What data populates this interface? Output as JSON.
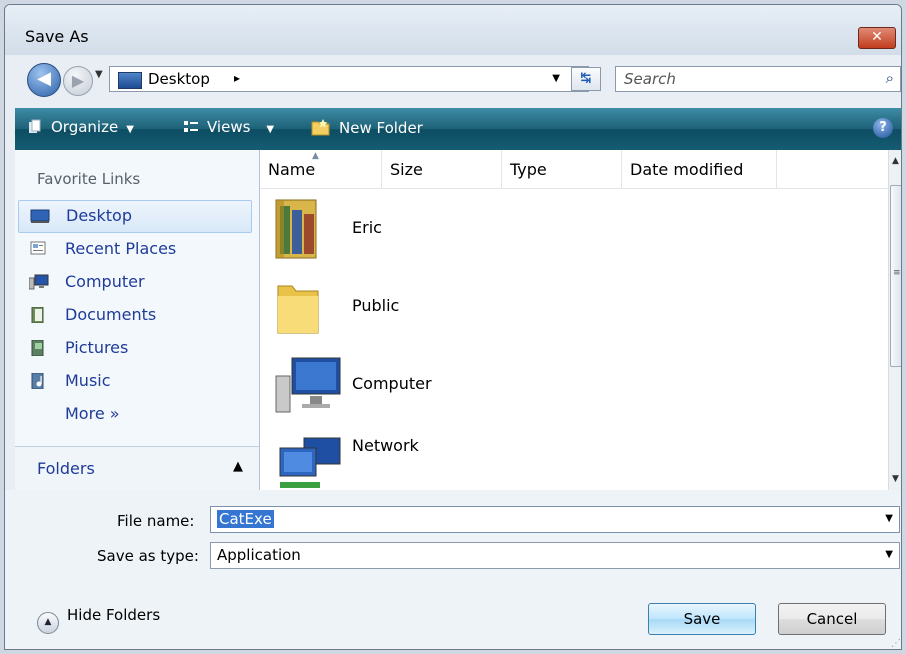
{
  "window": {
    "title": "Save As",
    "close_glyph": "✕"
  },
  "address": {
    "location": "Desktop",
    "separator": "▸",
    "dropdown": "▼"
  },
  "search": {
    "placeholder": "Search"
  },
  "toolbar": {
    "organize": "Organize",
    "views": "Views",
    "new_folder": "New Folder",
    "help": "?"
  },
  "nav": {
    "header": "Favorite Links",
    "items": [
      {
        "label": "Desktop",
        "icon": "desktop-icon"
      },
      {
        "label": "Recent Places",
        "icon": "recent-places-icon"
      },
      {
        "label": "Computer",
        "icon": "computer-icon"
      },
      {
        "label": "Documents",
        "icon": "documents-icon"
      },
      {
        "label": "Pictures",
        "icon": "pictures-icon"
      },
      {
        "label": "Music",
        "icon": "music-icon"
      }
    ],
    "more": "More »",
    "folders": "Folders",
    "folders_arrow": "▲"
  },
  "columns": [
    "Name",
    "Size",
    "Type",
    "Date modified"
  ],
  "files": [
    {
      "name": "Eric",
      "icon": "user-folder-icon"
    },
    {
      "name": "Public",
      "icon": "folder-icon"
    },
    {
      "name": "Computer",
      "icon": "computer-icon"
    },
    {
      "name": "Network",
      "icon": "network-icon"
    }
  ],
  "form": {
    "file_name_label": "File name:",
    "file_name_value": "CatExe",
    "save_type_label": "Save as type:",
    "save_type_value": "Application"
  },
  "buttons": {
    "hide_folders": "Hide Folders",
    "save": "Save",
    "cancel": "Cancel"
  },
  "colors": {
    "toolbar": "#155c73",
    "link": "#1f3b99",
    "selection": "#3476d2"
  }
}
